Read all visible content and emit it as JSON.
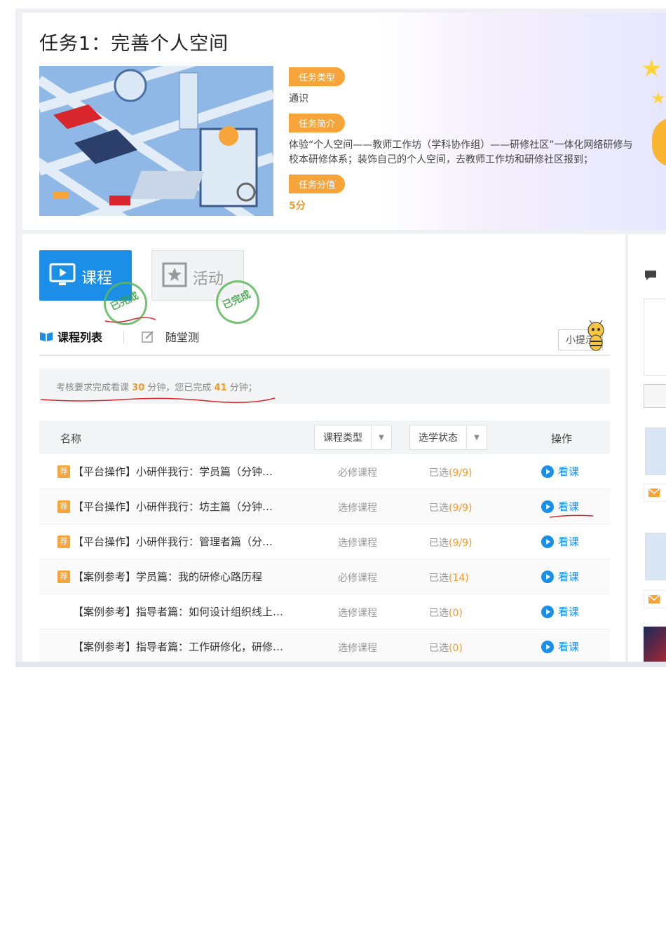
{
  "task": {
    "title": "任务1：完善个人空间",
    "type_tag": "任务类型",
    "type_value": "通识",
    "intro_tag": "任务简介",
    "intro_value": "体验“个人空间——教师工作坊（学科协作组）——研修社区”一体化网络研修与校本研修体系；装饰自己的个人空间，去教师工作坊和研修社区报到；",
    "score_tag": "任务分值",
    "score_value": "5分"
  },
  "tabs": {
    "course": "课程",
    "activity": "活动",
    "stamp_text": "已完成"
  },
  "subtabs": {
    "course_list": "课程列表",
    "quiz": "随堂测",
    "hint": "小提示"
  },
  "requirement": {
    "prefix": "考核要求完成看课",
    "required": "30",
    "mid": "分钟，您已完成",
    "done": "41",
    "suffix": "分钟；"
  },
  "table": {
    "col_name": "名称",
    "col_type": "课程类型",
    "col_status": "选学状态",
    "col_op": "操作",
    "rows": [
      {
        "badge": "荐",
        "name": "【平台操作】小研伴我行：学员篇（分钟…",
        "type": "必修课程",
        "status": "已选",
        "count": "(9/9)",
        "action": "看课"
      },
      {
        "badge": "荐",
        "name": "【平台操作】小研伴我行：坊主篇（分钟…",
        "type": "选修课程",
        "status": "已选",
        "count": "(9/9)",
        "action": "看课"
      },
      {
        "badge": "荐",
        "name": "【平台操作】小研伴我行：管理者篇（分…",
        "type": "选修课程",
        "status": "已选",
        "count": "(9/9)",
        "action": "看课"
      },
      {
        "badge": "荐",
        "name": "【案例参考】学员篇：我的研修心路历程",
        "type": "必修课程",
        "status": "已选",
        "count": "(14)",
        "action": "看课"
      },
      {
        "badge": "",
        "name": "【案例参考】指导者篇：如何设计组织线上…",
        "type": "选修课程",
        "status": "已选",
        "count": "(0)",
        "action": "看课"
      },
      {
        "badge": "",
        "name": "【案例参考】指导者篇：工作研修化，研修…",
        "type": "选修课程",
        "status": "已选",
        "count": "(0)",
        "action": "看课"
      }
    ]
  },
  "colors": {
    "accent_blue": "#1b8fe8",
    "accent_orange": "#f7a43b",
    "stamp_green": "#3aa043",
    "annotation_red": "#d9262c"
  }
}
